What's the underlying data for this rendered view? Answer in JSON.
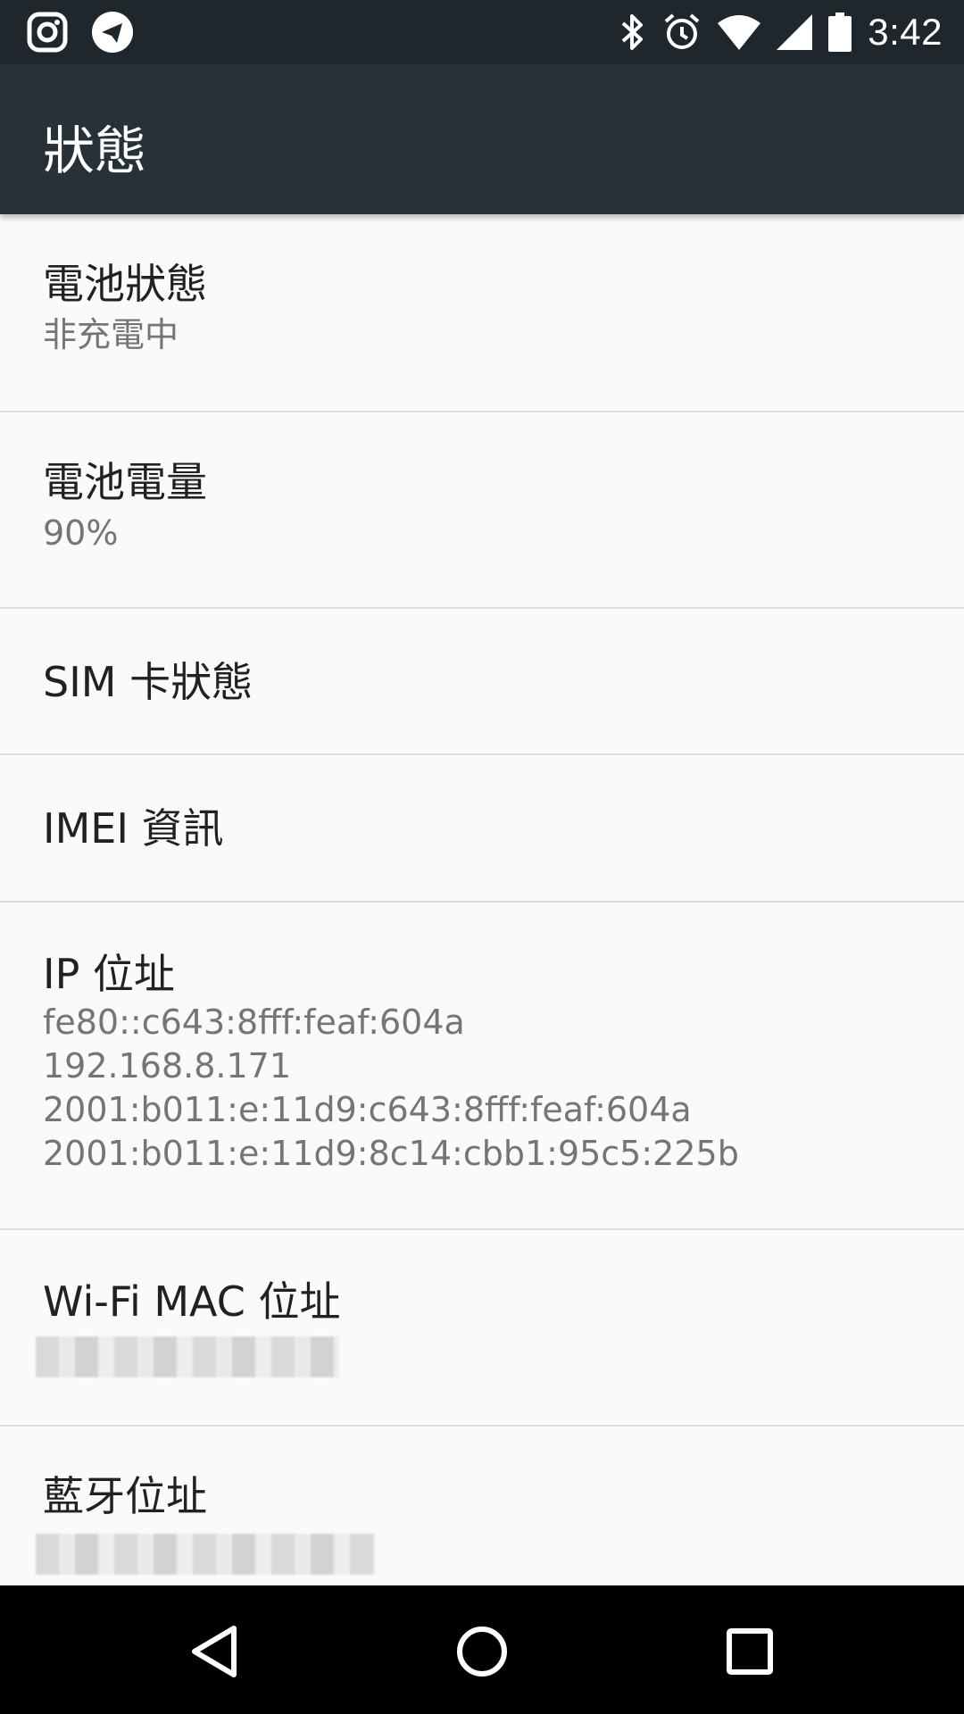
{
  "status_bar": {
    "left_icons": [
      "instagram-icon",
      "telegram-icon"
    ],
    "right_icons": [
      "bluetooth-icon",
      "alarm-icon",
      "wifi-icon",
      "cell-signal-icon",
      "battery-icon"
    ],
    "time": "3:42"
  },
  "app_bar": {
    "title": "狀態"
  },
  "items": [
    {
      "title": "電池狀態",
      "summary": "非充電中"
    },
    {
      "title": "電池電量",
      "summary": "90%"
    },
    {
      "title": "SIM 卡狀態"
    },
    {
      "title": "IMEI 資訊"
    },
    {
      "title": "IP 位址",
      "summary_lines": [
        "fe80::c643:8fff:feaf:604a",
        "192.168.8.171",
        "2001:b011:e:11d9:c643:8fff:feaf:604a",
        "2001:b011:e:11d9:8c14:cbb1:95c5:225b"
      ]
    },
    {
      "title": "Wi-Fi MAC 位址",
      "summary_redacted": true
    },
    {
      "title": "藍牙位址",
      "summary_redacted": true
    }
  ],
  "nav_bar": {
    "buttons": [
      "back-icon",
      "home-icon",
      "recents-icon"
    ]
  },
  "colors": {
    "status_bar_bg": "#1f272c",
    "app_bar_bg": "#263238",
    "list_bg": "#fafafa",
    "divider": "#dcdcdc",
    "title_text": "#212121",
    "summary_text": "#757575"
  }
}
